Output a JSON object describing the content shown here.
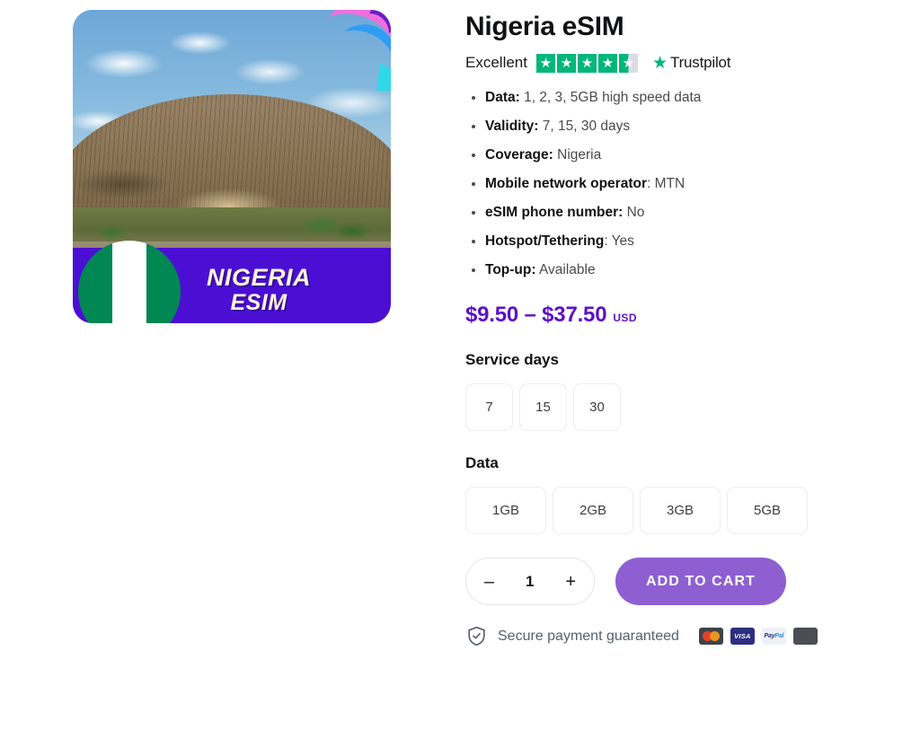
{
  "product": {
    "title": "Nigeria eSIM",
    "image": {
      "alt_subject": "Zuma Rock, Nigeria",
      "banner_line1": "NIGERIA",
      "banner_line2": "ESIM",
      "banner_color": "#4b0fd4",
      "banner_text_color": "#fbf4dc",
      "flag_colors": [
        "#008753",
        "#ffffff",
        "#008753"
      ],
      "logo_colors": [
        "#f06fe0",
        "#2f9df4",
        "#2fd9e8",
        "#6a1fc4"
      ]
    },
    "rating": {
      "label": "Excellent",
      "stars_total": 5,
      "stars_filled": 4,
      "stars_partial": 0.5,
      "brand": "Trustpilot",
      "star_color": "#00b67a",
      "empty_color": "#dcdce6"
    },
    "features": [
      {
        "label": "Data:",
        "value": "1, 2, 3, 5GB high speed data"
      },
      {
        "label": "Validity:",
        "value": "7, 15, 30 days"
      },
      {
        "label": "Coverage:",
        "value": "Nigeria"
      },
      {
        "label": "Mobile network operator",
        "value": ": MTN"
      },
      {
        "label": "eSIM phone number:",
        "value": "No"
      },
      {
        "label": "Hotspot/Tethering",
        "value": ": Yes"
      },
      {
        "label": "Top-up:",
        "value": "Available"
      }
    ],
    "price": {
      "range": "$9.50 – $37.50",
      "currency": "USD",
      "color": "#5b11c9"
    }
  },
  "options": {
    "service_days": {
      "label": "Service days",
      "values": [
        "7",
        "15",
        "30"
      ]
    },
    "data": {
      "label": "Data",
      "values": [
        "1GB",
        "2GB",
        "3GB",
        "5GB"
      ]
    }
  },
  "purchase": {
    "decrease_label": "–",
    "quantity": "1",
    "increase_label": "+",
    "add_to_cart_label": "ADD TO CART",
    "button_color": "#8e5fd1"
  },
  "secure_payment": {
    "text": "Secure payment guaranteed",
    "icon": "shield-check-icon",
    "methods": [
      {
        "name": "mastercard",
        "label": ""
      },
      {
        "name": "visa",
        "label": "VISA"
      },
      {
        "name": "paypal",
        "label": "PayPal"
      },
      {
        "name": "apple-pay",
        "label": ""
      }
    ]
  }
}
